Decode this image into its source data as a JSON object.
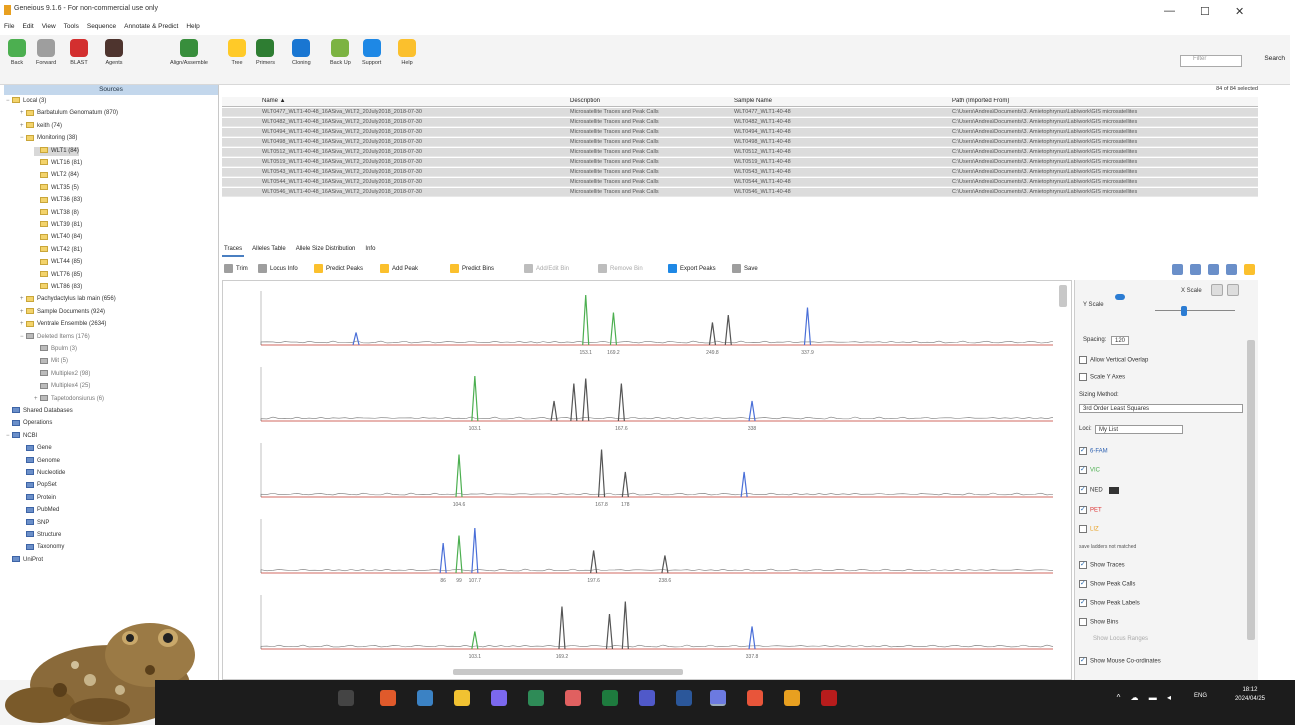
{
  "window": {
    "title": "Geneious 9.1.6 - For non-commercial use only",
    "minimize": "—",
    "maximize": "☐",
    "close": "✕"
  },
  "menu": [
    "File",
    "Edit",
    "View",
    "Tools",
    "Sequence",
    "Annotate & Predict",
    "Help"
  ],
  "toolbar": {
    "buttons": [
      {
        "label": "Back",
        "color": "#4caf50"
      },
      {
        "label": "Forward",
        "color": "#9e9e9e"
      },
      {
        "label": "BLAST",
        "color": "#d32f2f"
      },
      {
        "label": "Agents",
        "color": "#4e342e"
      },
      {
        "label": "Align/Assemble",
        "color": "#388e3c"
      },
      {
        "label": "Tree",
        "color": "#ffca28"
      },
      {
        "label": "Primers",
        "color": "#2e7d32"
      },
      {
        "label": "Cloning",
        "color": "#1976d2"
      },
      {
        "label": "Back Up",
        "color": "#7cb342"
      },
      {
        "label": "Support",
        "color": "#1e88e5"
      },
      {
        "label": "Help",
        "color": "#fbc02d"
      }
    ],
    "search_placeholder": "Filter",
    "search_label": "Search"
  },
  "sources": {
    "header": "Sources",
    "items": [
      {
        "label": "Local (3)",
        "indent": 0,
        "exp": "−",
        "kind": "folder"
      },
      {
        "label": "Barbatulum Genomatum (870)",
        "indent": 1,
        "exp": "+",
        "kind": "folder"
      },
      {
        "label": "keith (74)",
        "indent": 1,
        "exp": "+",
        "kind": "folder"
      },
      {
        "label": "Monitoring (38)",
        "indent": 1,
        "exp": "−",
        "kind": "folder"
      },
      {
        "label": "WLT1 (84)",
        "indent": 2,
        "exp": "",
        "kind": "folder",
        "selected": true
      },
      {
        "label": "WLT16 (81)",
        "indent": 2,
        "exp": "",
        "kind": "folder"
      },
      {
        "label": "WLT2 (84)",
        "indent": 2,
        "exp": "",
        "kind": "folder"
      },
      {
        "label": "WLT35 (5)",
        "indent": 2,
        "exp": "",
        "kind": "folder"
      },
      {
        "label": "WLT36 (83)",
        "indent": 2,
        "exp": "",
        "kind": "folder"
      },
      {
        "label": "WLT38 (8)",
        "indent": 2,
        "exp": "",
        "kind": "folder"
      },
      {
        "label": "WLT39 (81)",
        "indent": 2,
        "exp": "",
        "kind": "folder"
      },
      {
        "label": "WLT40 (84)",
        "indent": 2,
        "exp": "",
        "kind": "folder"
      },
      {
        "label": "WLT42 (81)",
        "indent": 2,
        "exp": "",
        "kind": "folder"
      },
      {
        "label": "WLT44 (85)",
        "indent": 2,
        "exp": "",
        "kind": "folder"
      },
      {
        "label": "WLT76 (85)",
        "indent": 2,
        "exp": "",
        "kind": "folder"
      },
      {
        "label": "WLT86 (83)",
        "indent": 2,
        "exp": "",
        "kind": "folder"
      },
      {
        "label": "Pachydactylus lab main (656)",
        "indent": 1,
        "exp": "+",
        "kind": "folder"
      },
      {
        "label": "Sample Documents (924)",
        "indent": 1,
        "exp": "+",
        "kind": "folder"
      },
      {
        "label": "Ventrale Ensemble (2634)",
        "indent": 1,
        "exp": "+",
        "kind": "folder"
      },
      {
        "label": "Deleted Items (176)",
        "indent": 1,
        "exp": "−",
        "kind": "gray"
      },
      {
        "label": "Bpulm (3)",
        "indent": 2,
        "exp": "",
        "kind": "gray"
      },
      {
        "label": "Mit (5)",
        "indent": 2,
        "exp": "",
        "kind": "gray"
      },
      {
        "label": "Multiplex2 (98)",
        "indent": 2,
        "exp": "",
        "kind": "gray"
      },
      {
        "label": "Multiplex4 (25)",
        "indent": 2,
        "exp": "",
        "kind": "gray"
      },
      {
        "label": "Tapetodonsiurus (6)",
        "indent": 2,
        "exp": "+",
        "kind": "gray"
      },
      {
        "label": "Shared Databases",
        "indent": 0,
        "exp": "",
        "kind": "blue"
      },
      {
        "label": "Operations",
        "indent": 0,
        "exp": "",
        "kind": "blue"
      },
      {
        "label": "NCBI",
        "indent": 0,
        "exp": "−",
        "kind": "blue"
      },
      {
        "label": "Gene",
        "indent": 1,
        "exp": "",
        "kind": "blue"
      },
      {
        "label": "Genome",
        "indent": 1,
        "exp": "",
        "kind": "blue"
      },
      {
        "label": "Nucleotide",
        "indent": 1,
        "exp": "",
        "kind": "blue"
      },
      {
        "label": "PopSet",
        "indent": 1,
        "exp": "",
        "kind": "blue"
      },
      {
        "label": "Protein",
        "indent": 1,
        "exp": "",
        "kind": "blue"
      },
      {
        "label": "PubMed",
        "indent": 1,
        "exp": "",
        "kind": "blue"
      },
      {
        "label": "SNP",
        "indent": 1,
        "exp": "",
        "kind": "blue"
      },
      {
        "label": "Structure",
        "indent": 1,
        "exp": "",
        "kind": "blue"
      },
      {
        "label": "Taxonomy",
        "indent": 1,
        "exp": "",
        "kind": "blue"
      },
      {
        "label": "UniProt",
        "indent": 0,
        "exp": "",
        "kind": "blue"
      }
    ]
  },
  "documents": {
    "count": "84 of 84 selected",
    "columns": [
      "Name ▲",
      "Description",
      "Sample Name",
      "Path (Imported From)"
    ],
    "rows": [
      [
        "WLT0477_WLT1-40-48_16ASiva_WLT2_20July2018_2018-07-30",
        "Microsatellite Traces and Peak Calls",
        "WLT0477_WLT1-40-48",
        "C:\\Users\\Andrea\\Documents\\3. Amietophrynus\\Lab\\work\\GIS microsatellites"
      ],
      [
        "WLT0482_WLT1-40-48_16ASiva_WLT2_20July2018_2018-07-30",
        "Microsatellite Traces and Peak Calls",
        "WLT0482_WLT1-40-48",
        "C:\\Users\\Andrea\\Documents\\3. Amietophrynus\\Lab\\work\\GIS microsatellites"
      ],
      [
        "WLT0494_WLT1-40-48_16ASiva_WLT2_20July2018_2018-07-30",
        "Microsatellite Traces and Peak Calls",
        "WLT0494_WLT1-40-48",
        "C:\\Users\\Andrea\\Documents\\3. Amietophrynus\\Lab\\work\\GIS microsatellites"
      ],
      [
        "WLT0498_WLT1-40-48_16ASiva_WLT2_20July2018_2018-07-30",
        "Microsatellite Traces and Peak Calls",
        "WLT0498_WLT1-40-48",
        "C:\\Users\\Andrea\\Documents\\3. Amietophrynus\\Lab\\work\\GIS microsatellites"
      ],
      [
        "WLT0512_WLT1-40-48_16ASiva_WLT2_20July2018_2018-07-30",
        "Microsatellite Traces and Peak Calls",
        "WLT0512_WLT1-40-48",
        "C:\\Users\\Andrea\\Documents\\3. Amietophrynus\\Lab\\work\\GIS microsatellites"
      ],
      [
        "WLT0519_WLT1-40-48_16ASiva_WLT2_20July2018_2018-07-30",
        "Microsatellite Traces and Peak Calls",
        "WLT0519_WLT1-40-48",
        "C:\\Users\\Andrea\\Documents\\3. Amietophrynus\\Lab\\work\\GIS microsatellites"
      ],
      [
        "WLT0543_WLT1-40-48_16ASiva_WLT2_20July2018_2018-07-30",
        "Microsatellite Traces and Peak Calls",
        "WLT0543_WLT1-40-48",
        "C:\\Users\\Andrea\\Documents\\3. Amietophrynus\\Lab\\work\\GIS microsatellites"
      ],
      [
        "WLT0544_WLT1-40-48_16ASiva_WLT2_20July2018_2018-07-30",
        "Microsatellite Traces and Peak Calls",
        "WLT0544_WLT1-40-48",
        "C:\\Users\\Andrea\\Documents\\3. Amietophrynus\\Lab\\work\\GIS microsatellites"
      ],
      [
        "WLT0546_WLT1-40-48_16ASiva_WLT2_20July2018_2018-07-30",
        "Microsatellite Traces and Peak Calls",
        "WLT0546_WLT1-40-48",
        "C:\\Users\\Andrea\\Documents\\3. Amietophrynus\\Lab\\work\\GIS microsatellites"
      ]
    ]
  },
  "tabs": [
    {
      "label": "Traces",
      "active": true
    },
    {
      "label": "Alleles Table",
      "active": false
    },
    {
      "label": "Allele Size Distribution",
      "active": false
    },
    {
      "label": "Info",
      "active": false
    }
  ],
  "trace_toolbar": [
    {
      "label": "Trim",
      "color": "#9e9e9e"
    },
    {
      "label": "Locus Info",
      "color": "#9e9e9e"
    },
    {
      "label": "Predict Peaks",
      "color": "#fbc02d"
    },
    {
      "label": "Add Peak",
      "color": "#fbc02d"
    },
    {
      "label": "Predict Bins",
      "color": "#fbc02d"
    },
    {
      "label": "Add/Edit Bin",
      "color": "#bdbdbd"
    },
    {
      "label": "Remove Bin",
      "color": "#bdbdbd"
    },
    {
      "label": "Export Peaks",
      "color": "#1e88e5"
    },
    {
      "label": "Save",
      "color": "#9e9e9e"
    }
  ],
  "traces": [
    {
      "peaks": [
        {
          "pos": 0.12,
          "h": 0.25,
          "color": "#4a6fd8"
        },
        {
          "pos": 0.41,
          "h": 1.0,
          "color": "#4caf50",
          "label": "153.1"
        },
        {
          "pos": 0.445,
          "h": 0.65,
          "color": "#4caf50",
          "label": "169.2"
        },
        {
          "pos": 0.57,
          "h": 0.45,
          "color": "#555555",
          "label": "249.8"
        },
        {
          "pos": 0.59,
          "h": 0.6,
          "color": "#555555"
        },
        {
          "pos": 0.69,
          "h": 0.75,
          "color": "#4a6fd8",
          "label": "337.9"
        }
      ]
    },
    {
      "peaks": [
        {
          "pos": 0.27,
          "h": 0.9,
          "color": "#4caf50",
          "label": "103.1"
        },
        {
          "pos": 0.37,
          "h": 0.4,
          "color": "#555555"
        },
        {
          "pos": 0.395,
          "h": 0.75,
          "color": "#555555"
        },
        {
          "pos": 0.41,
          "h": 0.85,
          "color": "#555555"
        },
        {
          "pos": 0.455,
          "h": 0.75,
          "color": "#555555",
          "label": "167.6"
        },
        {
          "pos": 0.62,
          "h": 0.4,
          "color": "#4a6fd8",
          "label": "338"
        }
      ]
    },
    {
      "peaks": [
        {
          "pos": 0.25,
          "h": 0.85,
          "color": "#4caf50",
          "label": "104.6"
        },
        {
          "pos": 0.43,
          "h": 0.95,
          "color": "#555555",
          "label": "167.8"
        },
        {
          "pos": 0.46,
          "h": 0.5,
          "color": "#555555",
          "label": "178"
        },
        {
          "pos": 0.61,
          "h": 0.5,
          "color": "#4a6fd8"
        }
      ]
    },
    {
      "peaks": [
        {
          "pos": 0.23,
          "h": 0.6,
          "color": "#4a6fd8",
          "label": "86"
        },
        {
          "pos": 0.25,
          "h": 0.75,
          "color": "#4caf50",
          "label": "99"
        },
        {
          "pos": 0.27,
          "h": 0.9,
          "color": "#4a6fd8",
          "label": "107.7"
        },
        {
          "pos": 0.42,
          "h": 0.45,
          "color": "#555555",
          "label": "197.6"
        },
        {
          "pos": 0.51,
          "h": 0.35,
          "color": "#555555",
          "label": "238.6"
        }
      ]
    },
    {
      "peaks": [
        {
          "pos": 0.27,
          "h": 0.35,
          "color": "#4caf50",
          "label": "103.1"
        },
        {
          "pos": 0.38,
          "h": 0.85,
          "color": "#555555",
          "label": "169.2"
        },
        {
          "pos": 0.44,
          "h": 0.7,
          "color": "#555555"
        },
        {
          "pos": 0.46,
          "h": 0.95,
          "color": "#555555"
        },
        {
          "pos": 0.62,
          "h": 0.45,
          "color": "#4a6fd8",
          "label": "337.8"
        }
      ]
    }
  ],
  "options": {
    "yscale_label": "Y Scale",
    "xscale_label": "X Scale",
    "spacing_label": "Spacing:",
    "spacing_value": "120",
    "allow_vertical_overlap": "Allow Vertical Overlap",
    "scale_y_axes": "Scale Y Axes",
    "sizing_method_label": "Sizing Method:",
    "sizing_method_value": "3rd Order Least Squares",
    "loci_label": "Loci:",
    "loci_value": "My List",
    "dye_1": "6-FAM",
    "dye_2": "VIC",
    "dye_3": "NED",
    "dye_4": "PET",
    "dye_5": "LIZ",
    "save_pattern": "save ladders not matched",
    "show_traces": "Show Traces",
    "show_peak_calls": "Show Peak Calls",
    "show_peak_labels": "Show Peak Labels",
    "show_bins": "Show Bins",
    "show_locus_ranges": "Show Locus Ranges",
    "show_mouse_coords": "Show Mouse Co-ordinates"
  },
  "taskbar": {
    "language": "ENG",
    "time": "18:12",
    "date": "2024/04/25"
  }
}
